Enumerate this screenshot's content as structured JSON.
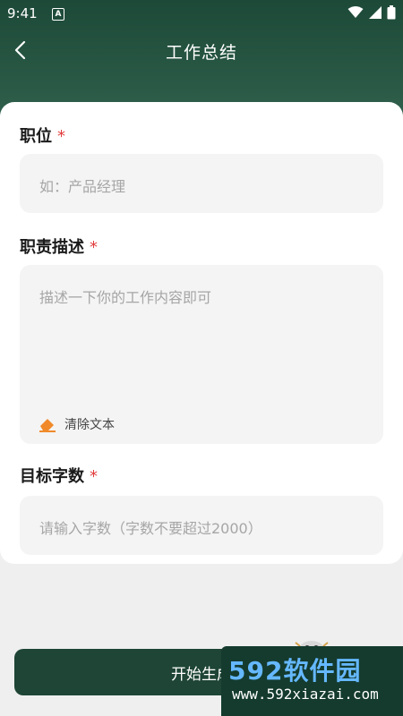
{
  "status": {
    "time": "9:41",
    "a_indicator": "A"
  },
  "nav": {
    "title": "工作总结"
  },
  "form": {
    "position": {
      "label": "职位",
      "required_mark": "*",
      "placeholder": "如：产品经理"
    },
    "duties": {
      "label": "职责描述",
      "required_mark": "*",
      "placeholder": "描述一下你的工作内容即可",
      "clear_label": "清除文本"
    },
    "word_count": {
      "label": "目标字数",
      "required_mark": "*",
      "placeholder": "请输入字数（字数不要超过2000）"
    }
  },
  "cta": {
    "label": "开始生成"
  },
  "watermark": {
    "brand": "592软件园",
    "url": "www.592xiazai.com"
  },
  "colors": {
    "header_green": "#1d4a38",
    "cta_green": "#1e4535",
    "required_red": "#e23c3c",
    "eraser_orange": "#f08a2a"
  },
  "icons": {
    "back": "chevron-left",
    "wifi": "wifi",
    "signal": "cell-signal",
    "battery": "battery",
    "eraser": "eraser"
  }
}
